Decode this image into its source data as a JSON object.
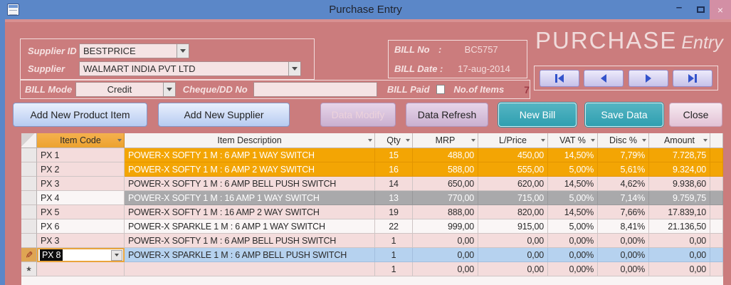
{
  "window": {
    "title": "Purchase Entry"
  },
  "header": {
    "supplier_id": {
      "label": "Supplier ID",
      "value": "BESTPRICE"
    },
    "supplier": {
      "label": "Supplier",
      "value": "WALMART INDIA PVT LTD"
    },
    "bill_no": {
      "label": "BILL No",
      "colon": ":",
      "value": "BC5757"
    },
    "bill_date": {
      "label": "BILL Date :",
      "value": "17-aug-2014"
    },
    "title_main": "PURCHASE",
    "title_sub": "Entry",
    "bill_mode": {
      "label": "BILL Mode",
      "value": "Credit"
    },
    "cheque_dd": {
      "label": "Cheque/DD No",
      "value": ""
    },
    "bill_paid": {
      "label": "BILL Paid",
      "checked": false
    },
    "no_of_items": {
      "label": "No.of Items",
      "value": "7"
    }
  },
  "toolbar": {
    "add_new_product_item": "Add New Product Item",
    "add_new_supplier": "Add New Supplier",
    "data_modify": "Data Modify",
    "data_refresh": "Data Refresh",
    "new_bill": "New Bill",
    "save_data": "Save Data",
    "close": "Close"
  },
  "table": {
    "columns": [
      "Item Code",
      "Item Description",
      "Qty",
      "MRP",
      "L/Price",
      "VAT %",
      "Disc %",
      "Amount"
    ],
    "rows": [
      {
        "item_code": "PX 1",
        "description": "POWER-X SOFTY 1 M : 6 AMP 1 WAY SWITCH",
        "qty": "15",
        "mrp": "488,00",
        "l_price": "450,00",
        "vat": "14,50%",
        "disc": "7,79%",
        "amount": "7.728,75",
        "highlight": "orange",
        "code_tone": "pink",
        "selector": "none",
        "editing": false
      },
      {
        "item_code": "PX 2",
        "description": "POWER-X SOFTY 1 M : 6 AMP 2 WAY SWITCH",
        "qty": "16",
        "mrp": "588,00",
        "l_price": "555,00",
        "vat": "5,00%",
        "disc": "5,61%",
        "amount": "9.324,00",
        "highlight": "orange",
        "code_tone": "pink",
        "selector": "none",
        "editing": false
      },
      {
        "item_code": "PX 3",
        "description": "POWER-X SOFTY 1 M : 6 AMP BELL PUSH SWITCH",
        "qty": "14",
        "mrp": "650,00",
        "l_price": "620,00",
        "vat": "14,50%",
        "disc": "4,62%",
        "amount": "9.938,60",
        "highlight": "pink",
        "code_tone": "pink",
        "selector": "none",
        "editing": false
      },
      {
        "item_code": "PX 4",
        "description": "POWER-X SOFTY 1 M : 16 AMP 1 WAY SWITCH",
        "qty": "13",
        "mrp": "770,00",
        "l_price": "715,00",
        "vat": "5,00%",
        "disc": "7,14%",
        "amount": "9.759,75",
        "highlight": "gray",
        "code_tone": "white",
        "selector": "none",
        "editing": false
      },
      {
        "item_code": "PX 5",
        "description": "POWER-X SOFTY 1 M : 16 AMP 2 WAY SWITCH",
        "qty": "19",
        "mrp": "888,00",
        "l_price": "820,00",
        "vat": "14,50%",
        "disc": "7,66%",
        "amount": "17.839,10",
        "highlight": "pink",
        "code_tone": "pink",
        "selector": "none",
        "editing": false
      },
      {
        "item_code": "PX 6",
        "description": "POWER-X SPARKLE 1 M : 6 AMP 1 WAY SWITCH",
        "qty": "22",
        "mrp": "999,00",
        "l_price": "915,00",
        "vat": "5,00%",
        "disc": "8,41%",
        "amount": "21.136,50",
        "highlight": "white",
        "code_tone": "white",
        "selector": "none",
        "editing": false
      },
      {
        "item_code": "PX 3",
        "description": "POWER-X SOFTY 1 M : 6 AMP BELL PUSH SWITCH",
        "qty": "1",
        "mrp": "0,00",
        "l_price": "0,00",
        "vat": "0,00%",
        "disc": "0,00%",
        "amount": "0,00",
        "highlight": "pink",
        "code_tone": "pink",
        "selector": "none",
        "editing": false
      },
      {
        "item_code": "PX 8",
        "description": "POWER-X SPARKLE 1 M : 6 AMP BELL PUSH SWITCH",
        "qty": "1",
        "mrp": "0,00",
        "l_price": "0,00",
        "vat": "0,00%",
        "disc": "0,00%",
        "amount": "0,00",
        "highlight": "blue",
        "code_tone": "white",
        "selector": "pencil",
        "editing": true
      },
      {
        "item_code": "",
        "description": "",
        "qty": "1",
        "mrp": "0,00",
        "l_price": "0,00",
        "vat": "0,00%",
        "disc": "0,00%",
        "amount": "0,00",
        "highlight": "pink",
        "code_tone": "pink",
        "selector": "new",
        "editing": false
      }
    ]
  },
  "colors": {
    "titlebar": "#5b87c8",
    "form_background": "#cb7c7d",
    "row_highlight_orange": "#f3a504",
    "row_highlight_gray": "#a9a9ab",
    "row_editing_blue": "#b6d2ef",
    "header_selected_amber": "#eca22e",
    "teal_button": "#2f9fb0",
    "items_count_red": "#9e3d47"
  }
}
